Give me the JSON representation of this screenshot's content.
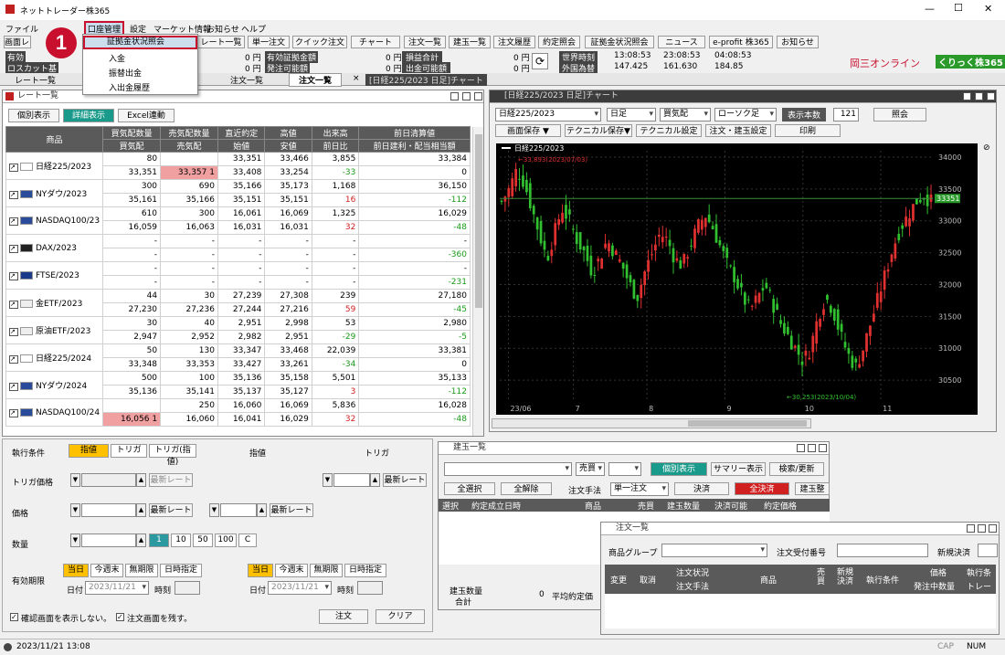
{
  "window": {
    "title": "ネットトレーダー株365",
    "ctl_min": "—",
    "ctl_max": "☐",
    "ctl_close": "✕"
  },
  "menubar": [
    "ファイル",
    "口座管理",
    "設定",
    "マーケット情報",
    "お知らせ",
    "ヘルプ"
  ],
  "dropdown": {
    "items": [
      "証拠金状況照会",
      "入金",
      "振替出金",
      "入出金履歴"
    ],
    "badge": "1"
  },
  "toolbar": [
    "画面レイ",
    "レート一覧",
    "単一注文",
    "クイック注文",
    "チャート",
    "注文一覧",
    "建玉一覧",
    "注文履歴",
    "約定照会",
    "証拠金状況照会",
    "ニュース",
    "e-profit 株365",
    "お知らせ"
  ],
  "account": {
    "left_labels": [
      "有効",
      "ロスカット基"
    ],
    "values_col1": [
      "0 円",
      "0 円"
    ],
    "labels2": [
      "有効証拠金額",
      "発注可能額"
    ],
    "values_col2": [
      "0 円",
      "0 円"
    ],
    "labels3": [
      "損益合計",
      "出金可能額"
    ],
    "values_col3": [
      "0 円",
      "0 円"
    ],
    "world_time_label": "世界時刻",
    "fx_label": "外国為替",
    "times": [
      "13:08:53",
      "23:08:53",
      "04:08:53"
    ],
    "fx": [
      "147.425",
      "161.630",
      "184.85"
    ]
  },
  "brand": {
    "name": "岡三オンライン",
    "badge": "くりっく株365"
  },
  "tabs": [
    "レート一覧",
    "",
    "注文一覧",
    "注文一覧",
    "[日経225/2023 日足]チャート"
  ],
  "rate_panel": {
    "title": "レート一覧",
    "buttons": [
      "個別表示",
      "詳細表示",
      "Excel連動"
    ],
    "headers_top": [
      "商品",
      "買気配数量",
      "売気配数量",
      "直近約定",
      "高値",
      "出来高",
      "前日清算値"
    ],
    "headers_bottom": [
      "",
      "買気配",
      "売気配",
      "始値",
      "安値",
      "前日比",
      "前日建利・配当相当額"
    ],
    "rows": [
      {
        "name": "日経225/2023",
        "r1": [
          "80",
          "",
          "33,351",
          "33,466",
          "3,855",
          "33,384"
        ],
        "r2": [
          "33,351",
          "33,357  1",
          "33,408",
          "33,254",
          "-33",
          "0"
        ]
      },
      {
        "name": "NYダウ/2023",
        "r1": [
          "300",
          "690",
          "35,166",
          "35,173",
          "1,168",
          "36,150"
        ],
        "r2": [
          "35,161",
          "35,166",
          "35,151",
          "35,151",
          "16",
          "-112"
        ]
      },
      {
        "name": "NASDAQ100/23",
        "r1": [
          "610",
          "300",
          "16,061",
          "16,069",
          "1,325",
          "16,029"
        ],
        "r2": [
          "16,059",
          "16,063",
          "16,031",
          "16,031",
          "32",
          "-48"
        ]
      },
      {
        "name": "DAX/2023",
        "r1": [
          "-",
          "-",
          "-",
          "-",
          "-",
          "-"
        ],
        "r2": [
          "-",
          "-",
          "-",
          "-",
          "-",
          "-360"
        ]
      },
      {
        "name": "FTSE/2023",
        "r1": [
          "-",
          "-",
          "-",
          "-",
          "-",
          "-"
        ],
        "r2": [
          "-",
          "-",
          "-",
          "-",
          "-",
          "-231"
        ]
      },
      {
        "name": "金ETF/2023",
        "r1": [
          "44",
          "30",
          "27,239",
          "27,308",
          "239",
          "27,180"
        ],
        "r2": [
          "27,230",
          "27,236",
          "27,244",
          "27,216",
          "59",
          "-45"
        ]
      },
      {
        "name": "原油ETF/2023",
        "r1": [
          "30",
          "40",
          "2,951",
          "2,998",
          "53",
          "2,980"
        ],
        "r2": [
          "2,947",
          "2,952",
          "2,982",
          "2,951",
          "-29",
          "-5"
        ]
      },
      {
        "name": "日経225/2024",
        "r1": [
          "50",
          "130",
          "33,347",
          "33,468",
          "22,039",
          "33,381"
        ],
        "r2": [
          "33,348",
          "33,353",
          "33,427",
          "33,261",
          "-34",
          "0"
        ]
      },
      {
        "name": "NYダウ/2024",
        "r1": [
          "500",
          "100",
          "35,136",
          "35,158",
          "5,501",
          "35,133"
        ],
        "r2": [
          "35,136",
          "35,141",
          "35,137",
          "35,127",
          "3",
          "-112"
        ]
      },
      {
        "name": "NASDAQ100/24",
        "r1": [
          "",
          "250",
          "16,060",
          "16,069",
          "5,836",
          "16,028"
        ],
        "r2": [
          "16,056  1",
          "16,060",
          "16,041",
          "16,029",
          "32",
          "-48"
        ]
      }
    ]
  },
  "chart_panel": {
    "title": "[日経225/2023 日足]チャート",
    "symbol": "日経225/2023",
    "period": "日足",
    "side": "買気配",
    "style": "ローソク足",
    "count_label": "表示本数",
    "count": "121",
    "query": "照会",
    "buttons2": [
      "画面保存 ▼",
      "テクニカル保存▼",
      "テクニカル設定",
      "注文・建玉設定",
      "印刷"
    ],
    "legend": "日経225/2023",
    "hi_note": "←33,893(2023/07/03)",
    "lo_note": "←30,253(2023/10/04)",
    "yticks": [
      "34000",
      "33500",
      "33000",
      "32500",
      "32000",
      "31500",
      "31000",
      "30500"
    ],
    "xticks": [
      "23/06",
      "7",
      "8",
      "9",
      "10",
      "11"
    ],
    "last_price": "33351"
  },
  "order_form": {
    "cond_label": "執行条件",
    "cond_opts": [
      "指値",
      "トリガ",
      "トリガ(指値)"
    ],
    "head2": "指値",
    "head3": "トリガ",
    "trigger_label": "トリガ価格",
    "latest": "最新レート",
    "price_label": "価格",
    "qty_label": "数量",
    "qty_opts": [
      "1",
      "10",
      "50",
      "100",
      "C"
    ],
    "valid_label": "有効期限",
    "valid_opts": [
      "当日",
      "今週末",
      "無期限",
      "日時指定"
    ],
    "date_label": "日付",
    "date": "2023/11/21",
    "time_label": "時刻",
    "chk1": "確認画面を表示しない。",
    "chk2": "注文画面を残す。",
    "order_btn": "注文",
    "clear_btn": "クリア"
  },
  "position_panel": {
    "title": "建玉一覧",
    "side": "売買",
    "btns": [
      "個別表示",
      "サマリー表示",
      "検索/更新"
    ],
    "row2": [
      "全選択",
      "全解除"
    ],
    "method_label": "注文手法",
    "method": "単一注文",
    "settle": "決済",
    "all_settle": "全決済",
    "tag": "建玉整",
    "headers": [
      "選択",
      "約定成立日時",
      "商品",
      "売買",
      "建玉数量",
      "決済可能",
      "約定価格"
    ],
    "sum_label1": "建玉数量",
    "sum_label2": "合計",
    "sum_value": "0",
    "avg_label": "平均約定価"
  },
  "orders_panel": {
    "title": "注文一覧",
    "group_label": "商品グループ",
    "no_label": "注文受付番号",
    "new_label": "新規決済",
    "headers": [
      "変更",
      "取消",
      "注文状況",
      "注文手法",
      "商品",
      "売買",
      "新規決済",
      "執行条件",
      "価格",
      "発注中数量",
      "執行条",
      "トレー"
    ]
  },
  "statusbar": {
    "datetime": "2023/11/21 13:08",
    "caps": "CAP",
    "num": "NUM"
  }
}
